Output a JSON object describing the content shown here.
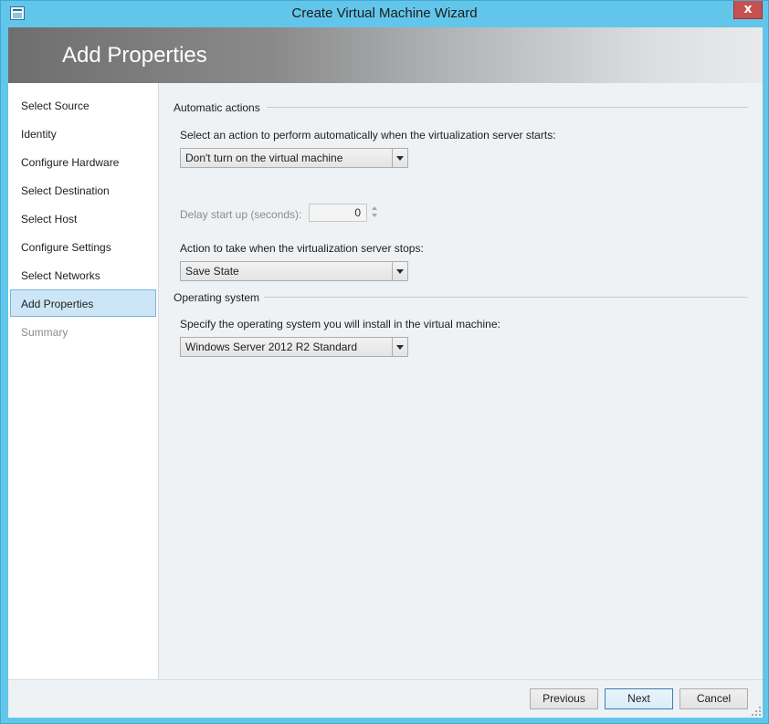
{
  "window": {
    "title": "Create Virtual Machine Wizard",
    "close_glyph": "x"
  },
  "header": {
    "title": "Add Properties"
  },
  "nav": {
    "items": [
      {
        "label": "Select Source",
        "state": "normal"
      },
      {
        "label": "Identity",
        "state": "normal"
      },
      {
        "label": "Configure Hardware",
        "state": "normal"
      },
      {
        "label": "Select Destination",
        "state": "normal"
      },
      {
        "label": "Select Host",
        "state": "normal"
      },
      {
        "label": "Configure Settings",
        "state": "normal"
      },
      {
        "label": "Select Networks",
        "state": "normal"
      },
      {
        "label": "Add Properties",
        "state": "selected"
      },
      {
        "label": "Summary",
        "state": "disabled"
      }
    ]
  },
  "automatic_actions": {
    "header": "Automatic actions",
    "start_prompt": "Select an action to perform automatically when the virtualization server starts:",
    "start_action": "Don't turn on the virtual machine",
    "delay_label": "Delay start up (seconds):",
    "delay_value": "0",
    "stop_prompt": "Action to take when the virtualization server stops:",
    "stop_action": "Save State"
  },
  "operating_system": {
    "header": "Operating system",
    "prompt": "Specify the operating system you will install in the virtual machine:",
    "value": "Windows Server 2012 R2 Standard"
  },
  "footer": {
    "previous": "Previous",
    "next": "Next",
    "cancel": "Cancel"
  },
  "colors": {
    "window_border": "#62c6ea",
    "selected_nav": "#cde6f7",
    "close_button": "#c75050"
  },
  "icons": [
    "app-icon",
    "close-icon",
    "dropdown-arrow-icon",
    "spin-up-icon",
    "spin-down-icon",
    "resize-grip-icon"
  ]
}
